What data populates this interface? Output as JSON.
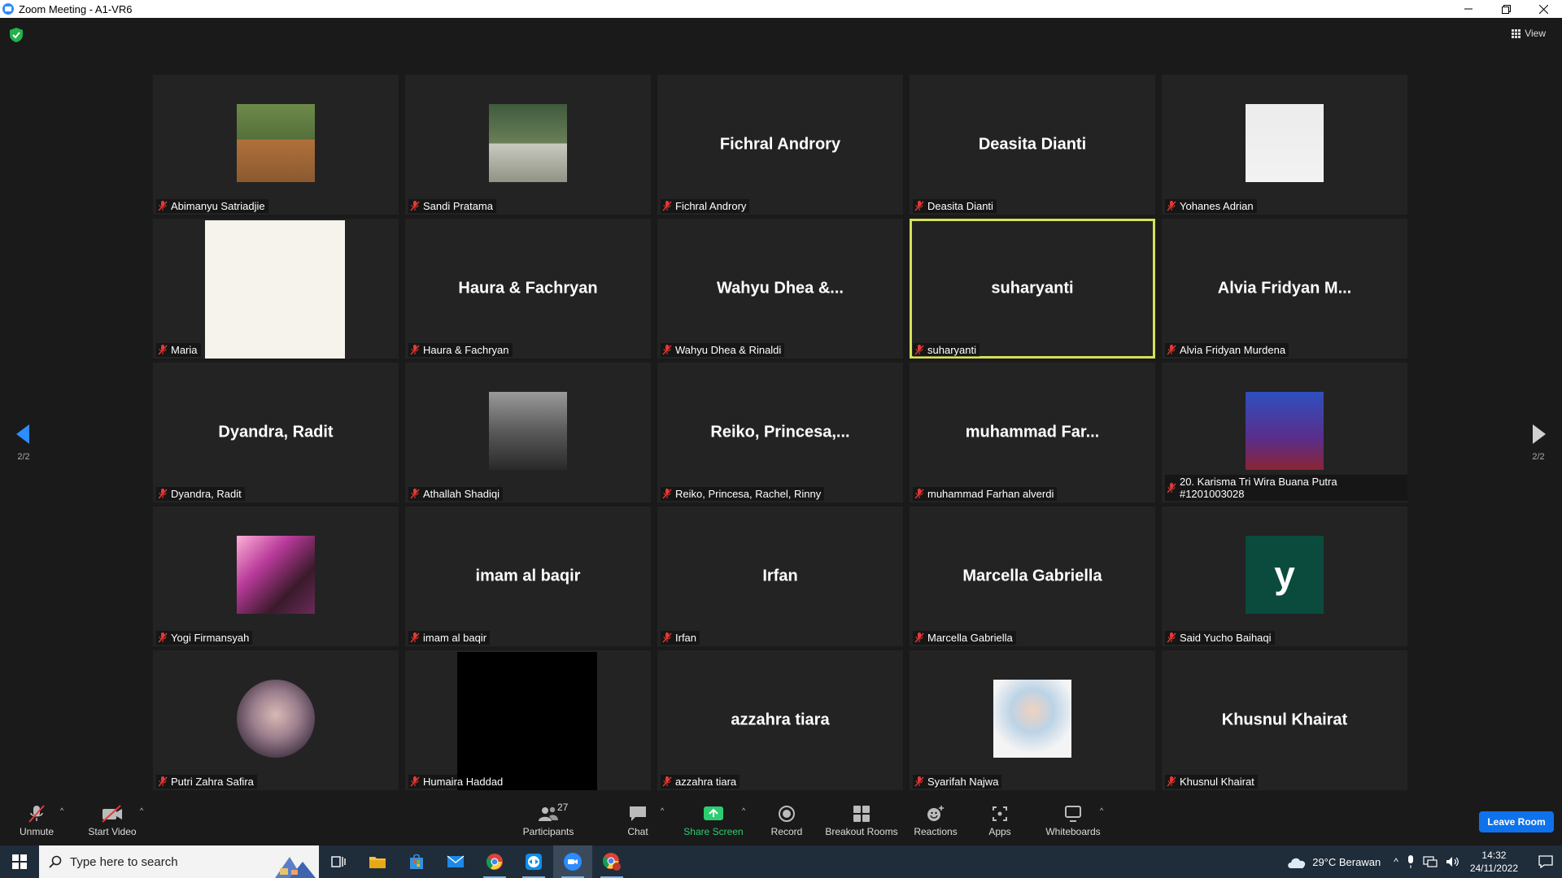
{
  "window": {
    "title": "Zoom Meeting - A1-VR6"
  },
  "view_label": "View",
  "pagination": {
    "left": "2/2",
    "right": "2/2"
  },
  "participants": [
    {
      "name": "Abimanyu Satriadjie",
      "display": "",
      "photo": "ph1"
    },
    {
      "name": "Sandi Pratama",
      "display": "",
      "photo": "ph2"
    },
    {
      "name": "Fichral Androry",
      "display": "Fichral Androry",
      "photo": ""
    },
    {
      "name": "Deasita Dianti",
      "display": "Deasita Dianti",
      "photo": ""
    },
    {
      "name": "Yohanes Adrian",
      "display": "",
      "photo": "ph3"
    },
    {
      "name": "Maria",
      "display": "",
      "photo": "ph4"
    },
    {
      "name": "Haura & Fachryan",
      "display": "Haura & Fachryan",
      "photo": ""
    },
    {
      "name": "Wahyu Dhea & Rinaldi",
      "display": "Wahyu Dhea &...",
      "photo": ""
    },
    {
      "name": "suharyanti",
      "display": "suharyanti",
      "photo": "",
      "active": true
    },
    {
      "name": "Alvia Fridyan Murdena",
      "display": "Alvia  Fridyan  M...",
      "photo": ""
    },
    {
      "name": "Dyandra, Radit",
      "display": "Dyandra, Radit",
      "photo": ""
    },
    {
      "name": "Athallah Shadiqi",
      "display": "",
      "photo": "ph5"
    },
    {
      "name": "Reiko, Princesa, Rachel, Rinny",
      "display": "Reiko,  Princesa,...",
      "photo": ""
    },
    {
      "name": "muhammad Farhan alverdi",
      "display": "muhammad  Far...",
      "photo": ""
    },
    {
      "name": "20. Karisma Tri Wira Buana Putra #1201003028",
      "display": "",
      "photo": "ph6"
    },
    {
      "name": "Yogi Firmansyah",
      "display": "",
      "photo": "ph7"
    },
    {
      "name": "imam al baqir",
      "display": "imam al baqir",
      "photo": ""
    },
    {
      "name": "Irfan",
      "display": "Irfan",
      "photo": ""
    },
    {
      "name": "Marcella Gabriella",
      "display": "Marcella Gabriella",
      "photo": ""
    },
    {
      "name": "Said Yucho Baihaqi",
      "display": "",
      "photo": "ph8",
      "avatar_letter": "y"
    },
    {
      "name": "Putri Zahra Safira",
      "display": "",
      "photo": "ph9"
    },
    {
      "name": "Humaira Haddad",
      "display": "",
      "photo": "ph10"
    },
    {
      "name": "azzahra tiara",
      "display": "azzahra tiara",
      "photo": ""
    },
    {
      "name": "Syarifah Najwa",
      "display": "",
      "photo": "ph11"
    },
    {
      "name": "Khusnul Khairat",
      "display": "Khusnul Khairat",
      "photo": ""
    }
  ],
  "toolbar": {
    "unmute": "Unmute",
    "start_video": "Start Video",
    "participants": "Participants",
    "participants_count": "27",
    "chat": "Chat",
    "share_screen": "Share Screen",
    "record": "Record",
    "breakout_rooms": "Breakout Rooms",
    "reactions": "Reactions",
    "apps": "Apps",
    "whiteboards": "Whiteboards",
    "leave_room": "Leave Room"
  },
  "taskbar": {
    "search_placeholder": "Type here to search",
    "weather": "29°C  Berawan",
    "time": "14:32",
    "date": "24/11/2022"
  },
  "colors": {
    "accent": "#0e72ed",
    "active_speaker": "#d4e157",
    "share_green": "#2ecc71",
    "muted_red": "#e53935"
  }
}
